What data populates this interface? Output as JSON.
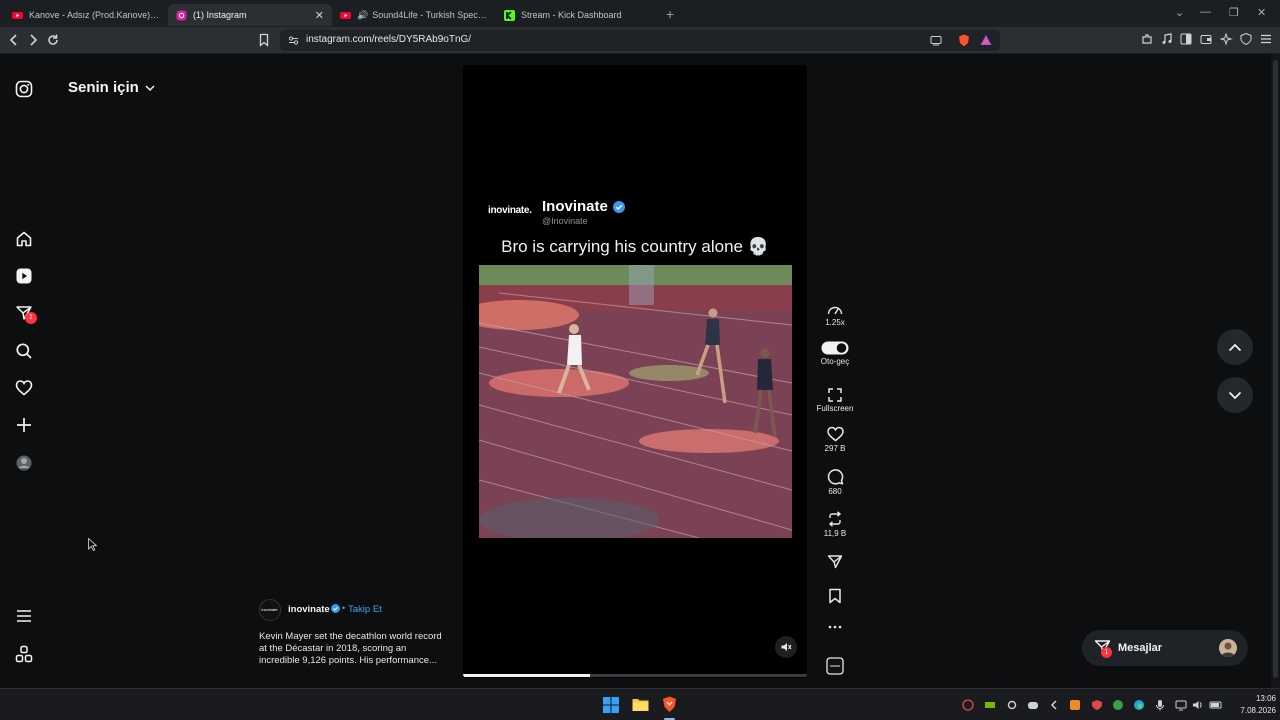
{
  "browser": {
    "tabs": [
      {
        "title": "Kanove - Adsız (Prod.Kanove) - YouTube",
        "icon": "youtube-icon",
        "active": false
      },
      {
        "title": "(1) Instagram",
        "icon": "instagram-icon",
        "active": true
      },
      {
        "title": "Sound4Life - Turkish Special Live",
        "icon": "youtube-icon",
        "active": false
      },
      {
        "title": "Stream - Kick Dashboard",
        "icon": "kick-icon",
        "active": false
      }
    ],
    "url": "instagram.com/reels/DY5RAb9oTnG/"
  },
  "sidebar": {
    "header": "Senin için",
    "notification_badge": "1"
  },
  "reel": {
    "account_logo_text": "inovinate.",
    "account_name": "Inovinate",
    "account_handle": "@Inovinate",
    "caption_overlay": "Bro is carrying his country alone 💀",
    "poster_username": "inovinate",
    "follow_label": "Takip Et",
    "description": "Kevin Mayer set the decathlon world record at the Décastar in 2018, scoring an incredible 9,126 points. His performance...",
    "progress": 0.37
  },
  "actions": {
    "speed": "1.25x",
    "autoplay": "Oto-geç",
    "fullscreen": "Fullscreen",
    "likes": "297 B",
    "comments": "680",
    "reposts": "11,9 B"
  },
  "messages": {
    "label": "Mesajlar",
    "badge": "1"
  },
  "taskbar": {
    "time": "13:06",
    "date": "7.08.2026"
  },
  "colors": {
    "accent_blue": "#3897f0",
    "badge_red": "#ff3040",
    "track": "#7b4255"
  }
}
